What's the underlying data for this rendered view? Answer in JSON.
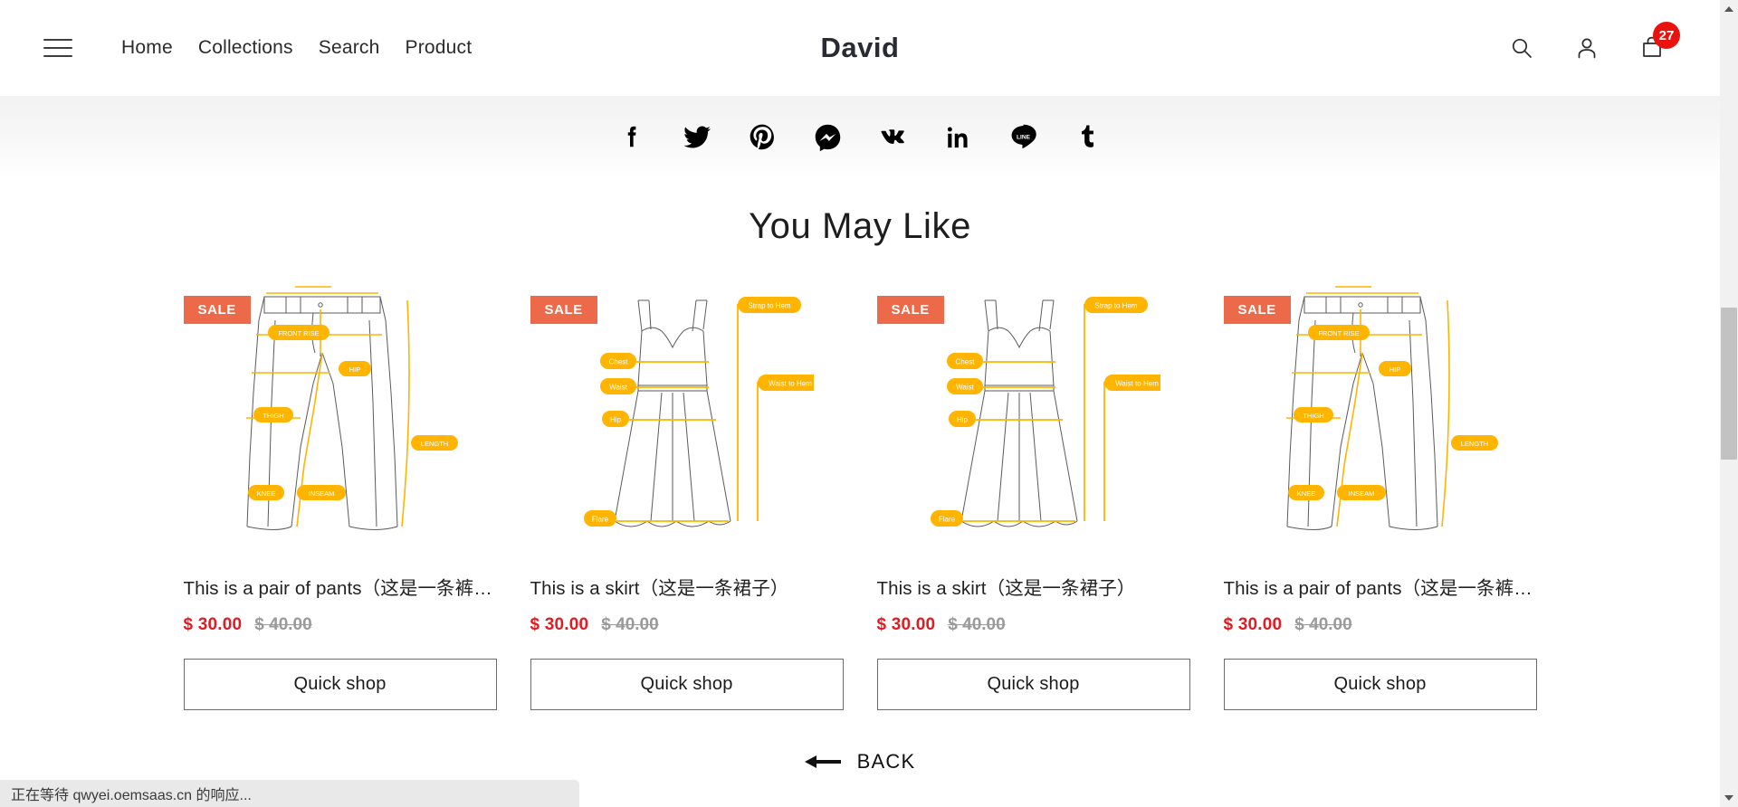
{
  "site": {
    "logo": "David"
  },
  "header": {
    "menu_icon": "hamburger-icon",
    "nav": [
      {
        "label": "Home"
      },
      {
        "label": "Collections"
      },
      {
        "label": "Search"
      },
      {
        "label": "Product"
      }
    ],
    "actions": {
      "search_icon": "search-icon",
      "account_icon": "account-icon",
      "cart_icon": "cart-icon",
      "cart_count": "27",
      "cart_badge_color": "#e8130f"
    }
  },
  "social": {
    "items": [
      {
        "name": "facebook-icon",
        "label": "Facebook"
      },
      {
        "name": "twitter-icon",
        "label": "Twitter"
      },
      {
        "name": "pinterest-icon",
        "label": "Pinterest"
      },
      {
        "name": "messenger-icon",
        "label": "Messenger"
      },
      {
        "name": "vk-icon",
        "label": "VK"
      },
      {
        "name": "linkedin-icon",
        "label": "LinkedIn"
      },
      {
        "name": "line-icon",
        "label": "LINE"
      },
      {
        "name": "tumblr-icon",
        "label": "Tumblr"
      }
    ]
  },
  "main": {
    "section_title": "You May Like",
    "badge_label": "SALE",
    "badge_color": "#ec6a4a",
    "quick_shop_label": "Quick shop",
    "sale_price_color": "#e01b22",
    "compare_price_color": "#9a9a9a",
    "accent_color": "#ffb400",
    "products": [
      {
        "type": "pants",
        "title": "This is a pair of pants（这是一条裤子…",
        "price": "$ 30.00",
        "compare_at": "$ 40.00",
        "badge": "SALE",
        "measurements": [
          "FRONT RISE",
          "HIP",
          "THIGH",
          "KNEE",
          "INSEAM",
          "LENGTH"
        ]
      },
      {
        "type": "skirt",
        "title": "This is a skirt（这是一条裙子）",
        "price": "$ 30.00",
        "compare_at": "$ 40.00",
        "badge": "SALE",
        "measurements": [
          "Chest",
          "Waist",
          "Hip",
          "Flare",
          "Strap to Hem",
          "Waist to Hem"
        ]
      },
      {
        "type": "skirt",
        "title": "This is a skirt（这是一条裙子）",
        "price": "$ 30.00",
        "compare_at": "$ 40.00",
        "badge": "SALE",
        "measurements": [
          "Chest",
          "Waist",
          "Hip",
          "Flare",
          "Strap to Hem",
          "Waist to Hem"
        ]
      },
      {
        "type": "pants",
        "title": "This is a pair of pants（这是一条裤子…",
        "price": "$ 30.00",
        "compare_at": "$ 40.00",
        "badge": "SALE",
        "measurements": [
          "FRONT RISE",
          "HIP",
          "THIGH",
          "KNEE",
          "INSEAM",
          "LENGTH"
        ]
      }
    ],
    "back": {
      "icon": "arrow-left-icon",
      "label": "BACK"
    }
  },
  "browser": {
    "status_text": "正在等待 qwyei.oemsaas.cn 的响应..."
  }
}
